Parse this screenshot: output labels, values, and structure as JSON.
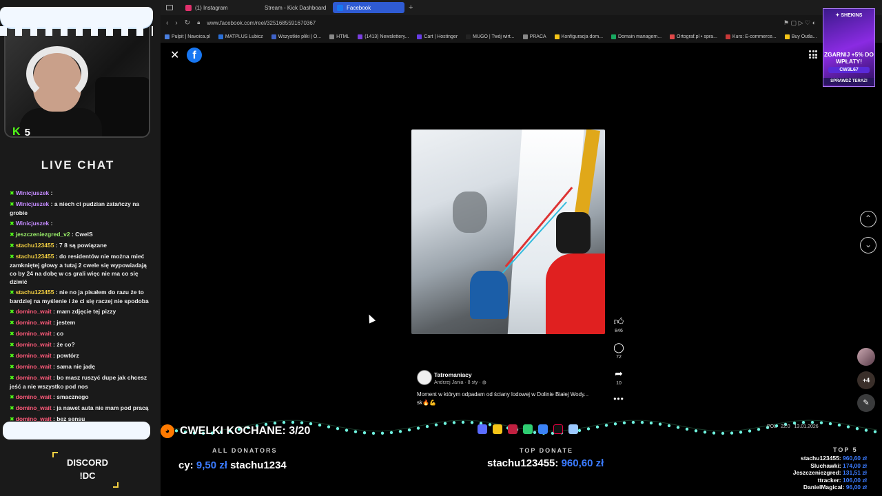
{
  "stream": {
    "viewer_count": "5",
    "live_chat_title": "LIVE CHAT",
    "chat": [
      {
        "user": "Winicjuszek",
        "color": "purple",
        "text": ":"
      },
      {
        "user": "Winicjuszek",
        "color": "purple",
        "text": ": a niech ci pudzian zatańczy na grobie"
      },
      {
        "user": "Winicjuszek",
        "color": "purple",
        "text": ":"
      },
      {
        "user": "jeszczeniezgred_v2",
        "color": "green",
        "text": ": CwelS"
      },
      {
        "user": "stachu123455",
        "color": "yellow",
        "text": ": 7 8 są powiązane"
      },
      {
        "user": "stachu123455",
        "color": "yellow",
        "text": ": do residentów nie można mieć zamkniętej głowy a tutaj 2 cwele się wypowiadają co by 24 na dobę w cs grali więc nie ma co się dziwić"
      },
      {
        "user": "stachu123455",
        "color": "yellow",
        "text": ": nie no ja pisałem do razu że to bardziej na myślenie i że ci się raczej nie spodoba"
      },
      {
        "user": "domino_wait",
        "color": "red",
        "text": ": mam zdjęcie tej pizzy"
      },
      {
        "user": "domino_wait",
        "color": "red",
        "text": ": jestem"
      },
      {
        "user": "domino_wait",
        "color": "red",
        "text": ": co"
      },
      {
        "user": "domino_wait",
        "color": "red",
        "text": ": że co?"
      },
      {
        "user": "domino_wait",
        "color": "red",
        "text": ": powtórz"
      },
      {
        "user": "domino_wait",
        "color": "red",
        "text": ": sama nie jadę"
      },
      {
        "user": "domino_wait",
        "color": "red",
        "text": ": bo masz ruszyć dupe jak chcesz jeść a nie wszystko pod nos"
      },
      {
        "user": "domino_wait",
        "color": "red",
        "text": ": smacznego"
      },
      {
        "user": "domino_wait",
        "color": "red",
        "text": ": ja nawet auta nie mam pod pracą"
      },
      {
        "user": "domino_wait",
        "color": "red",
        "text": ": bez sensu"
      }
    ],
    "discord_line1": "DISCORD",
    "discord_line2": "!DC"
  },
  "browser": {
    "tabs": [
      {
        "label": "(1) Instagram",
        "color": "#e1306c"
      },
      {
        "label": "Stream - Kick Dashboard",
        "color": "#53fc18"
      },
      {
        "label": "Facebook",
        "color": "#1877f2"
      }
    ],
    "new_tab": "+",
    "url": "www.facebook.com/reel/3251685591670367",
    "bookmarks": [
      {
        "label": "Pulpit | Navoica.pl",
        "color": "#4a7fe0"
      },
      {
        "label": "MATPLUS Lubicz",
        "color": "#2a6fd6"
      },
      {
        "label": "Wszystkie pliki | O...",
        "color": "#3f62c8"
      },
      {
        "label": "HTML",
        "color": "#888888"
      },
      {
        "label": "(1413) Newslettery...",
        "color": "#7a3fe0"
      },
      {
        "label": "Cart | Hostinger",
        "color": "#673de6"
      },
      {
        "label": "MUGO | Twój wirt...",
        "color": "#222222"
      },
      {
        "label": "PRACA",
        "color": "#888888"
      },
      {
        "label": "Konfiguracja dom...",
        "color": "#f5c518"
      },
      {
        "label": "Domain managem...",
        "color": "#18a860"
      },
      {
        "label": "Ortograf.pl • spra...",
        "color": "#e04848"
      },
      {
        "label": "Kurs: E-commerce...",
        "color": "#c83838"
      },
      {
        "label": "Buy Outla...",
        "color": "#f5c518"
      }
    ]
  },
  "reel": {
    "likes": "846",
    "comments": "72",
    "shares": "10",
    "page_name": "Tatromaniacy",
    "author_line": "Andrzej Jania · 8 sty · ",
    "caption": "Moment w którym odpadam od ściany lodowej w Dolinie Białej Wody...",
    "caption2": "sk🔥💪",
    "more_count": "+4"
  },
  "ad": {
    "brand": "✦ SHEKINS",
    "headline": "ZGARNIJ +5% DO WPŁATY!",
    "code": "CW3L67",
    "cta": "SPRAWDŹ TERAZ!"
  },
  "overlay": {
    "goal": "CWELKI KOCHANE: 3/20",
    "all_donators_label": "ALL DONATORS",
    "all_donators_line_prefix": "cy:",
    "all_donators_amount": "9,50 zł",
    "all_donators_line_suffix": "stachu1234",
    "top_donate_label": "TOP DONATE",
    "top_donate_name": "stachu123455:",
    "top_donate_amount": "960,60 zł",
    "top5_label": "TOP 5",
    "top5": [
      {
        "name": "stachu123455:",
        "amount": "960,60 zł"
      },
      {
        "name": "Sluchawki:",
        "amount": "174,00 zł"
      },
      {
        "name": "Jeszczeniezgred:",
        "amount": "131,51 zł"
      },
      {
        "name": "ttracker:",
        "amount": "106,00 zł"
      },
      {
        "name": "DanielMagical:",
        "amount": "96,00 zł"
      }
    ],
    "tray_lang": "POL",
    "tray_time": "22:0",
    "tray_date": "13.01.2026"
  }
}
